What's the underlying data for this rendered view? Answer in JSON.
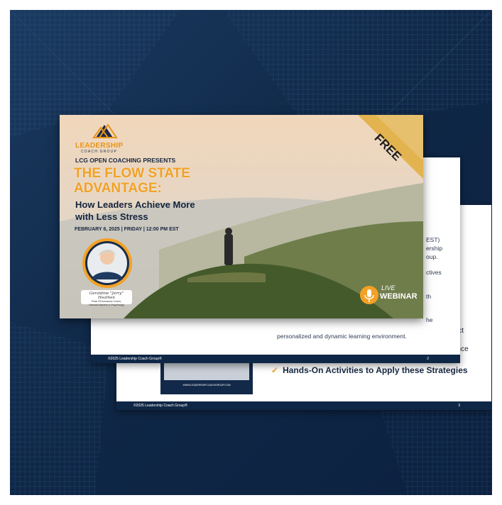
{
  "hero": {
    "logo_word": "LEADERSHIP",
    "logo_sub": "COACH GROUP",
    "presents": "LCG OPEN COACHING PRESENTS",
    "title_line1": "THE FLOW STATE",
    "title_line2": "ADVANTAGE:",
    "subtitle_line1": "How Leaders Achieve More",
    "subtitle_line2": "with Less Stress",
    "date": "FEBRUARY 6, 2025 | FRIDAY | 12:00 PM EST",
    "speaker_name": "Geraldine \"Jerry\" Heathen",
    "speaker_role1": "Peak Performance Coach,",
    "speaker_role2": "Harvard Masters in Psychology",
    "ribbon": "FREE",
    "badge_live": "LIVE",
    "badge_webinar": "WEBINAR"
  },
  "page2": {
    "body_text": "personalized and dynamic learning environment.",
    "peek_lines": [
      "EST)",
      "ership",
      "oup.",
      "ctives",
      "th",
      "he"
    ],
    "footer_left": "©2025 Leadership Coach Group®",
    "footer_right": "2"
  },
  "page3": {
    "peek_right": [
      "flict",
      "ence"
    ],
    "bullet": "Hands-On Activities to Apply these Strategies",
    "url": "WWW.LEADERSHIPCOACHGROUP.COM",
    "footer_left": "©2025 Leadership Coach Group®",
    "footer_right": "3",
    "logo_fragment": "SHIP"
  },
  "colors": {
    "navy": "#0f2746",
    "gold": "#f2a126"
  }
}
